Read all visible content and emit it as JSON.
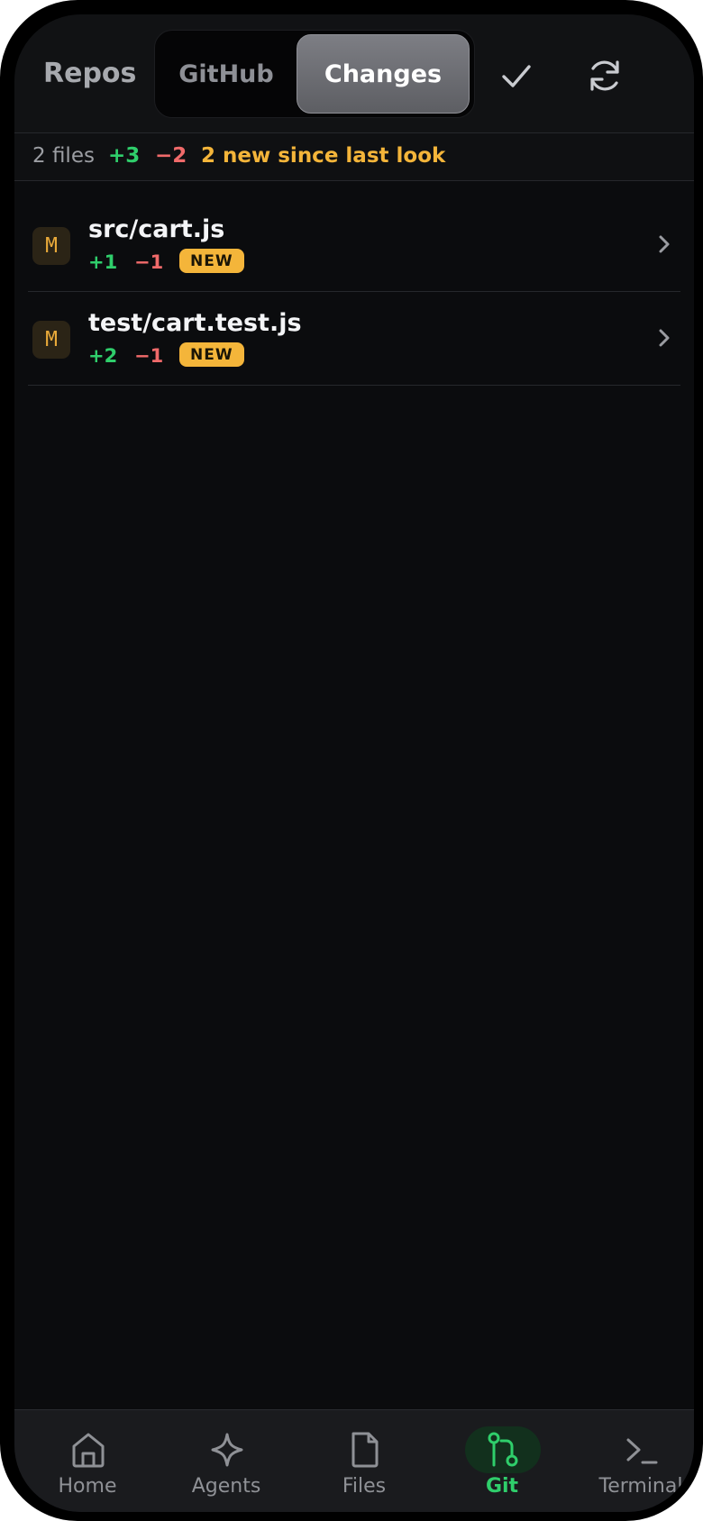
{
  "header": {
    "repos_label": "Repos",
    "tabs": [
      {
        "label": "GitHub",
        "active": false
      },
      {
        "label": "Changes",
        "active": true
      }
    ],
    "actions": [
      "check-icon",
      "refresh-icon"
    ]
  },
  "summary": {
    "files": "2 files",
    "additions": "+3",
    "deletions": "−2",
    "new_since": "2 new since last look"
  },
  "files": [
    {
      "status": "M",
      "path": "src/cart.js",
      "additions": "+1",
      "deletions": "−1",
      "badge": "NEW"
    },
    {
      "status": "M",
      "path": "test/cart.test.js",
      "additions": "+2",
      "deletions": "−1",
      "badge": "NEW"
    }
  ],
  "nav": {
    "items": [
      {
        "label": "Home",
        "icon": "home-icon"
      },
      {
        "label": "Agents",
        "icon": "sparkle-icon"
      },
      {
        "label": "Files",
        "icon": "file-icon"
      },
      {
        "label": "Git",
        "icon": "git-pull-request-icon",
        "active": true
      },
      {
        "label": "Terminal",
        "icon": "terminal-icon"
      }
    ]
  },
  "colors": {
    "accent_green": "#2fce6b",
    "deletion_red": "#f06a6a",
    "new_amber": "#f4b53a",
    "background": "#0b0c0e"
  }
}
